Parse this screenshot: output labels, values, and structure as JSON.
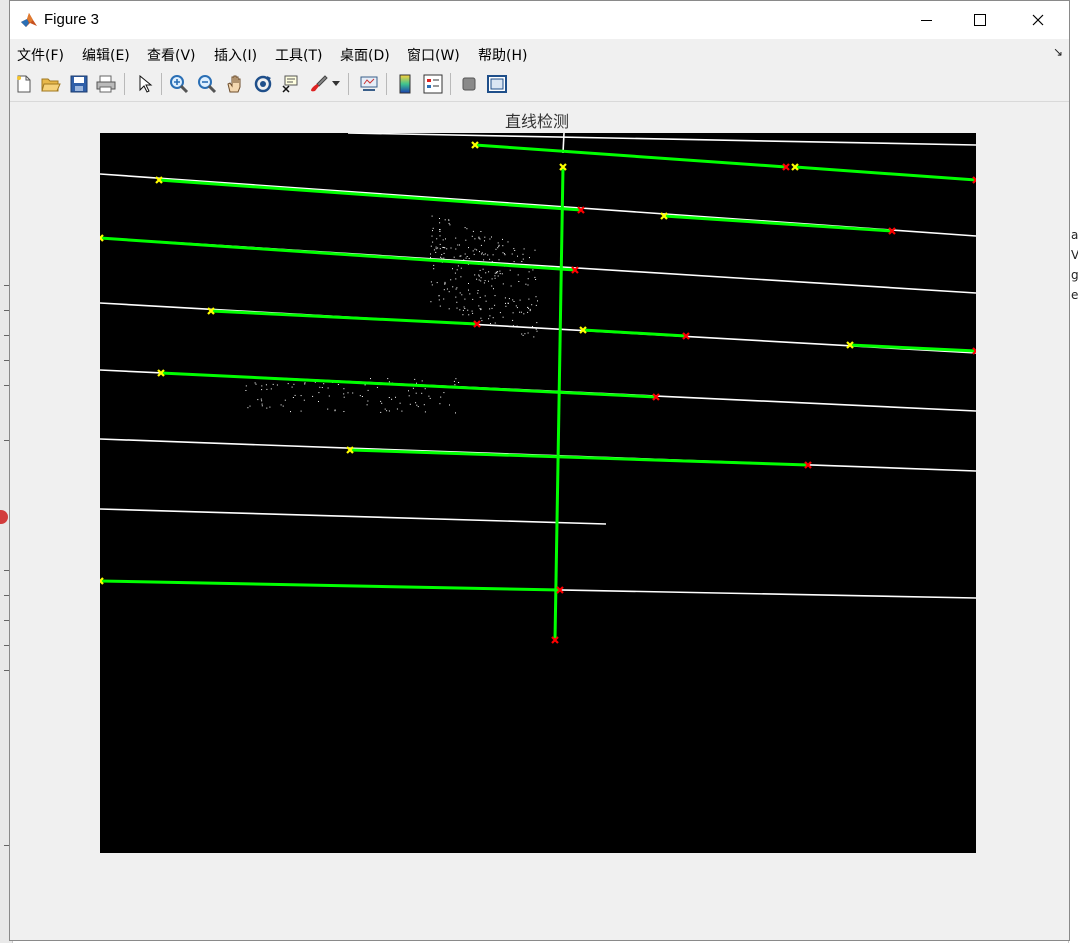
{
  "window": {
    "title": "Figure 3",
    "minimize_label": "Minimize",
    "maximize_label": "Maximize",
    "close_label": "Close"
  },
  "menu": [
    {
      "label": "文件(F)"
    },
    {
      "label": "编辑(E)"
    },
    {
      "label": "查看(V)"
    },
    {
      "label": "插入(I)"
    },
    {
      "label": "工具(T)"
    },
    {
      "label": "桌面(D)"
    },
    {
      "label": "窗口(W)"
    },
    {
      "label": "帮助(H)"
    }
  ],
  "toolbar": {
    "icons": [
      "new-figure-icon",
      "open-file-icon",
      "save-icon",
      "print-icon",
      "edit-plot-arrow-icon",
      "zoom-in-icon",
      "zoom-out-icon",
      "pan-hand-icon",
      "rotate-3d-icon",
      "data-cursor-icon",
      "brush-icon",
      "brush-dropdown-icon",
      "link-plot-icon",
      "insert-colorbar-icon",
      "insert-legend-icon",
      "hide-plot-tools-icon",
      "show-plot-tools-icon"
    ]
  },
  "plot": {
    "title": "直线检测",
    "colors": {
      "background": "#000000",
      "white_lines": "#ffffff",
      "detected_lines": "#00ff00",
      "start_marker": "#ffff00",
      "end_marker": "#ff0000"
    }
  },
  "background_fragments": {
    "right": [
      "ac",
      "V",
      "gu",
      "e"
    ]
  }
}
